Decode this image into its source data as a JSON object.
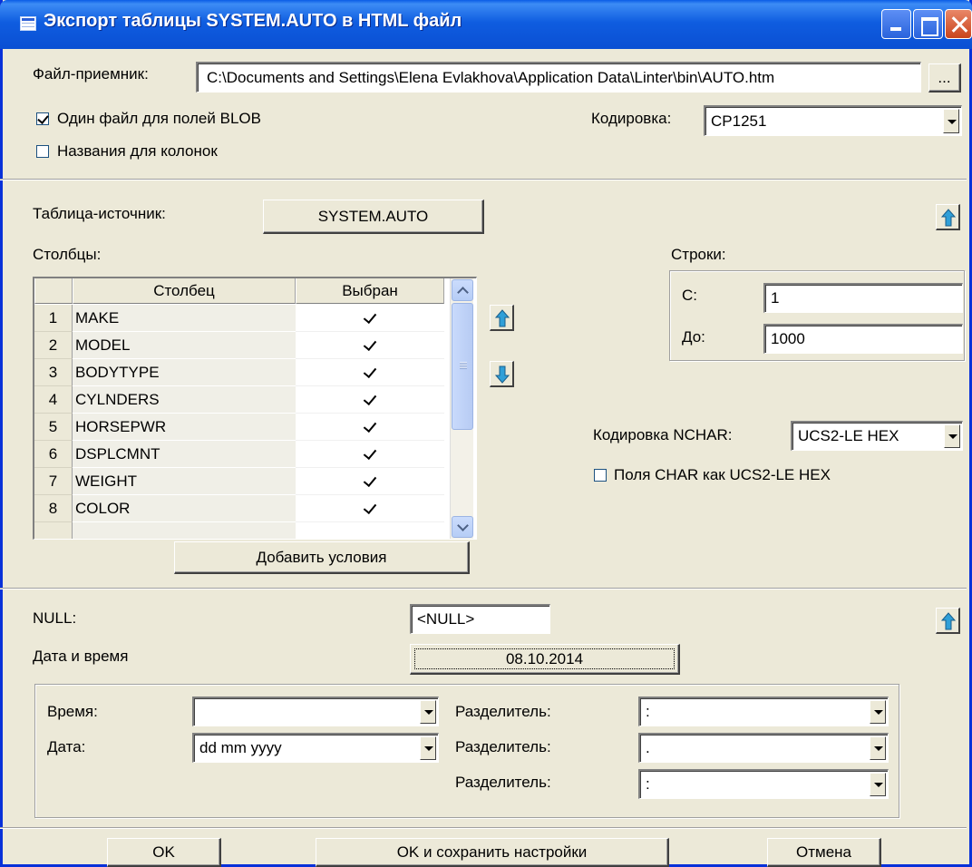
{
  "window": {
    "title": "Экспорт таблицы SYSTEM.AUTO в HTML файл"
  },
  "file": {
    "label": "Файл-приемник:",
    "path": "C:\\Documents and Settings\\Elena Evlakhova\\Application Data\\Linter\\bin\\AUTO.htm",
    "browse_label": "..."
  },
  "options": {
    "one_file_blob": {
      "label": "Один файл для полей BLOB",
      "checked": true
    },
    "column_names": {
      "label": "Названия для колонок",
      "checked": false
    }
  },
  "encoding": {
    "label": "Кодировка:",
    "value": "CP1251"
  },
  "source": {
    "label": "Таблица-источник:",
    "table_button": "SYSTEM.AUTO"
  },
  "columns": {
    "label": "Столбцы:",
    "headers": [
      "Столбец",
      "Выбран"
    ],
    "rows": [
      {
        "num": "1",
        "name": "MAKE",
        "selected": true
      },
      {
        "num": "2",
        "name": "MODEL",
        "selected": true
      },
      {
        "num": "3",
        "name": "BODYTYPE",
        "selected": true
      },
      {
        "num": "4",
        "name": "CYLNDERS",
        "selected": true
      },
      {
        "num": "5",
        "name": "HORSEPWR",
        "selected": true
      },
      {
        "num": "6",
        "name": "DSPLCMNT",
        "selected": true
      },
      {
        "num": "7",
        "name": "WEIGHT",
        "selected": true
      },
      {
        "num": "8",
        "name": "COLOR",
        "selected": true
      }
    ],
    "add_conditions_button": "Добавить условия"
  },
  "rows_range": {
    "label": "Строки:",
    "from_label": "С:",
    "from_value": "1",
    "to_label": "До:",
    "to_value": "1000"
  },
  "nchar": {
    "label": "Кодировка NCHAR:",
    "value": "UCS2-LE HEX",
    "char_as_ucs2": {
      "label": "Поля CHAR как UCS2-LE HEX",
      "checked": false
    }
  },
  "null_value": {
    "label": "NULL:",
    "value": "<NULL>"
  },
  "datetime": {
    "label": "Дата и время",
    "preview_button": "08.10.2014",
    "time_label": "Время:",
    "time_value": "",
    "date_label": "Дата:",
    "date_value": "dd mm yyyy",
    "sep_label": "Разделитель:",
    "time_sep": ":",
    "date_sep": ".",
    "third_sep": ":"
  },
  "buttons": {
    "ok": "OK",
    "ok_save": "OK и сохранить настройки",
    "cancel": "Отмена"
  },
  "colors": {
    "titlebar": "#0a4fd3",
    "dialog_bg": "#ece9d8",
    "arrow_icon": "#2f9fd8"
  }
}
